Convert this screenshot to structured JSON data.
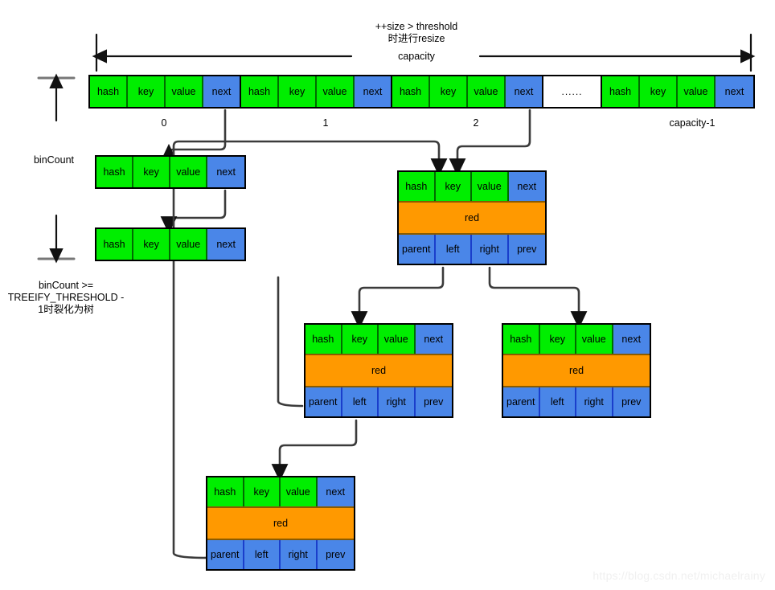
{
  "diagram": {
    "title_note": "++size > threshold\n时进行resize",
    "capacity_label": "capacity",
    "bin_count_label": "binCount",
    "treeify_note": "binCount >=\nTREEIFY_THRESHOLD -\n1时裂化为树",
    "watermark": "https://blog.csdn.net/michaelrainy"
  },
  "colors": {
    "green": "#00EE00",
    "blue": "#4A86E8",
    "orange": "#FF9900",
    "white": "#FFFFFF",
    "stroke": "#000000",
    "wire": "#3b3b3b"
  },
  "node_fields": {
    "hash": "hash",
    "key": "key",
    "value": "value",
    "next": "next",
    "color": "red",
    "parent": "parent",
    "left": "left",
    "right": "right",
    "prev": "prev"
  },
  "table": {
    "index_labels": [
      "0",
      "1",
      "2",
      "capacity-1"
    ],
    "gap_label": "......",
    "buckets": [
      {
        "index": "0",
        "cells": [
          "hash",
          "key",
          "value",
          "next"
        ]
      },
      {
        "index": "1",
        "cells": [
          "hash",
          "key",
          "value",
          "next"
        ]
      },
      {
        "index": "2",
        "cells": [
          "hash",
          "key",
          "value",
          "next"
        ]
      },
      {
        "index": "capacity-1",
        "cells": [
          "hash",
          "key",
          "value",
          "next"
        ]
      }
    ]
  },
  "chain_nodes": [
    {
      "id": "chain-node-1",
      "cells": [
        "hash",
        "key",
        "value",
        "next"
      ]
    },
    {
      "id": "chain-node-2",
      "cells": [
        "hash",
        "key",
        "value",
        "next"
      ]
    }
  ],
  "tree_nodes": [
    {
      "id": "tree-root",
      "row1": [
        "hash",
        "key",
        "value",
        "next"
      ],
      "row2": "red",
      "row3": [
        "parent",
        "left",
        "right",
        "prev"
      ]
    },
    {
      "id": "tree-left-child",
      "row1": [
        "hash",
        "key",
        "value",
        "next"
      ],
      "row2": "red",
      "row3": [
        "parent",
        "left",
        "right",
        "prev"
      ]
    },
    {
      "id": "tree-right-child",
      "row1": [
        "hash",
        "key",
        "value",
        "next"
      ],
      "row2": "red",
      "row3": [
        "parent",
        "left",
        "right",
        "prev"
      ]
    },
    {
      "id": "tree-grandchild",
      "row1": [
        "hash",
        "key",
        "value",
        "next"
      ],
      "row2": "red",
      "row3": [
        "parent",
        "left",
        "right",
        "prev"
      ]
    }
  ]
}
